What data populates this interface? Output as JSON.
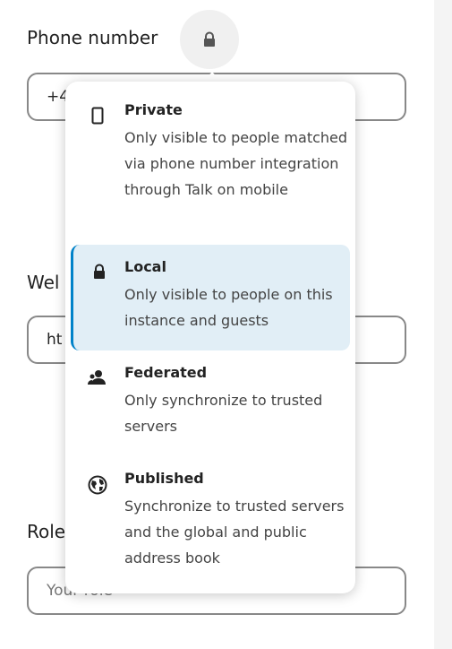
{
  "form": {
    "phone_label": "Phone number",
    "phone_value": "+4",
    "website_label": "Wel",
    "website_value": "ht",
    "role_label": "Role",
    "role_placeholder": "Your role"
  },
  "scope_menu": {
    "options": [
      {
        "icon": "phone-icon",
        "title": "Private",
        "description": "Only visible to people matched via phone number integration through Talk on mobile"
      },
      {
        "icon": "lock-icon",
        "title": "Local",
        "description": "Only visible to people on this instance and guests",
        "selected": true
      },
      {
        "icon": "federated-users-icon",
        "title": "Federated",
        "description": "Only synchronize to trusted servers"
      },
      {
        "icon": "globe-icon",
        "title": "Published",
        "description": "Synchronize to trusted servers and the global and public address book"
      }
    ]
  },
  "colors": {
    "selected_bg": "#e1eef6",
    "selected_border": "#0082c9",
    "field_border": "#888888"
  }
}
